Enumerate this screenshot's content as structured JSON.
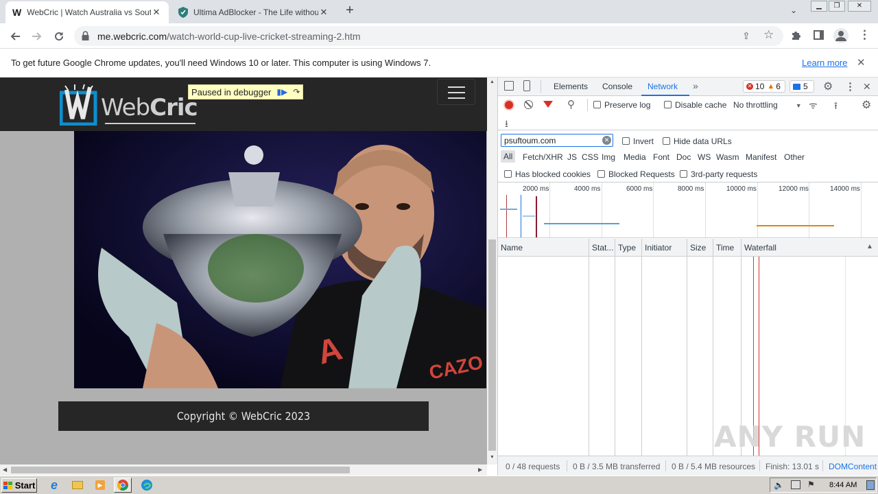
{
  "browser": {
    "tabs": [
      {
        "title": "WebCric | Watch Australia vs South",
        "active": true
      },
      {
        "title": "Ultima AdBlocker - The Life without A",
        "active": false
      }
    ],
    "url_host": "me.webcric.com",
    "url_path": "/watch-world-cup-live-cricket-streaming-2.htm",
    "infobar": {
      "message": "To get future Google Chrome updates, you'll need Windows 10 or later. This computer is using Windows 7.",
      "learn_more": "Learn more"
    }
  },
  "page": {
    "logo_text_a": "Web",
    "logo_text_b": "Cric",
    "paused_label": "Paused in debugger",
    "footer_text": "Copyright © WebCric 2023"
  },
  "devtools": {
    "tabs": [
      "Elements",
      "Console",
      "Network"
    ],
    "active_tab": "Network",
    "errors": "10",
    "warnings": "6",
    "messages": "5",
    "preserve_log": "Preserve log",
    "disable_cache": "Disable cache",
    "throttling": "No throttling",
    "filter_value": "psuftoum.com",
    "invert": "Invert",
    "hide_data_urls": "Hide data URLs",
    "type_filters": [
      "All",
      "Fetch/XHR",
      "JS",
      "CSS",
      "Img",
      "Media",
      "Font",
      "Doc",
      "WS",
      "Wasm",
      "Manifest",
      "Other"
    ],
    "has_blocked_cookies": "Has blocked cookies",
    "blocked_requests": "Blocked Requests",
    "third_party": "3rd-party requests",
    "timeline_ticks": [
      "2000 ms",
      "4000 ms",
      "6000 ms",
      "8000 ms",
      "10000 ms",
      "12000 ms",
      "14000 ms"
    ],
    "columns": [
      "Name",
      "Stat...",
      "Type",
      "Initiator",
      "Size",
      "Time",
      "Waterfall"
    ],
    "status": {
      "requests": "0 / 48 requests",
      "transferred": "0 B / 3.5 MB transferred",
      "resources": "0 B / 5.4 MB resources",
      "finish": "Finish: 13.01 s",
      "domcontent": "DOMContent"
    }
  },
  "taskbar": {
    "start": "Start",
    "clock": "8:44 AM"
  },
  "watermark": "ANY RUN"
}
